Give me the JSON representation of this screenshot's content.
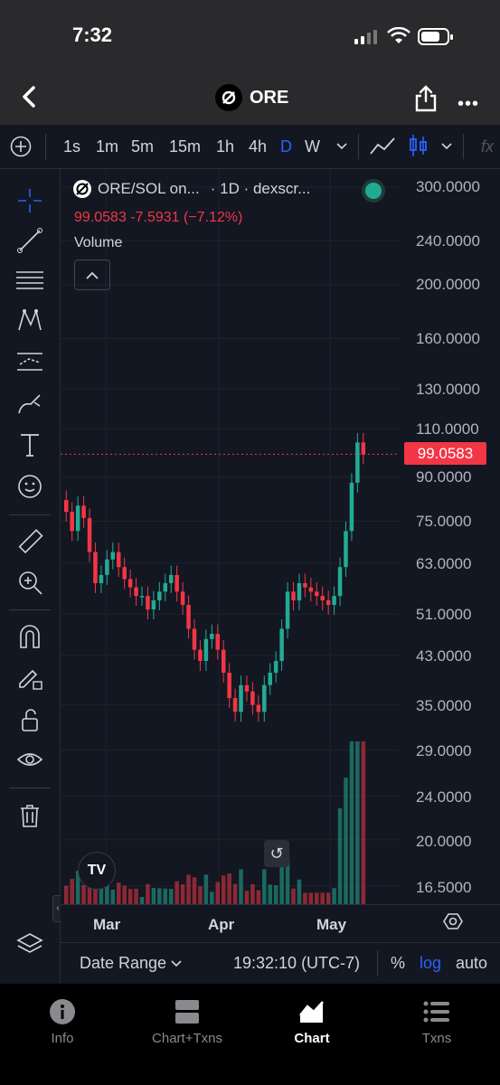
{
  "status_bar": {
    "time": "7:32"
  },
  "nav": {
    "title": "ORE"
  },
  "toolbar": {
    "intervals": [
      "1s",
      "1m",
      "5m",
      "15m",
      "1h",
      "4h",
      "D",
      "W"
    ],
    "active_interval": "D",
    "fx_label": "fx"
  },
  "legend": {
    "symbol": "ORE/SOL on...",
    "meta": "· 1D · dexscr...",
    "price_line": "99.0583  -7.5931 (−7.12%)",
    "volume_label": "Volume"
  },
  "price_axis": [
    "300.0000",
    "240.0000",
    "200.0000",
    "160.0000",
    "130.0000",
    "110.0000",
    "90.0000",
    "75.0000",
    "63.0000",
    "51.0000",
    "43.0000",
    "35.0000",
    "29.0000",
    "24.0000",
    "20.0000",
    "16.5000"
  ],
  "current_price_tag": "99.0583",
  "time_axis": [
    "Mar",
    "Apr",
    "May"
  ],
  "bottom_bar": {
    "date_range": "Date Range",
    "clock": "19:32:10 (UTC-7)",
    "percent": "%",
    "log": "log",
    "auto": "auto"
  },
  "tabs": [
    {
      "label": "Info",
      "icon": "info-icon"
    },
    {
      "label": "Chart+Txns",
      "icon": "split-layout-icon"
    },
    {
      "label": "Chart",
      "icon": "chart-icon",
      "active": true
    },
    {
      "label": "Txns",
      "icon": "list-icon"
    }
  ],
  "chart_data": {
    "type": "candlestick",
    "x_axis": [
      "Mar",
      "Apr",
      "May"
    ],
    "y_scale": "log",
    "ylim": [
      16.5,
      300
    ],
    "close": [
      78,
      72,
      80,
      76,
      66,
      58,
      60,
      64,
      66,
      62,
      59,
      57,
      55,
      55,
      52,
      54,
      56,
      58,
      60,
      56,
      53,
      48,
      44,
      42,
      46,
      47,
      44,
      40,
      36,
      34,
      38,
      37,
      35,
      34,
      38,
      40,
      42,
      48,
      56,
      54,
      58,
      57,
      56,
      55,
      54,
      53,
      55,
      62,
      72,
      88,
      104,
      99
    ],
    "up_color": "#22ab94",
    "down_color": "#f23645",
    "last_price": 99.0583,
    "change": -7.5931,
    "change_pct": -7.12
  }
}
